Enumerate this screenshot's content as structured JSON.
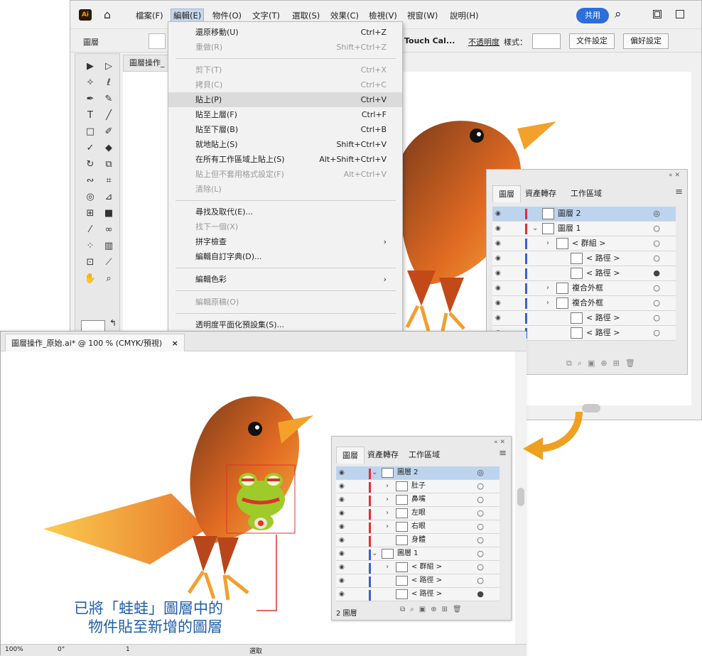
{
  "menubar": {
    "items": [
      "檔案(F)",
      "編輯(E)",
      "物件(O)",
      "文字(T)",
      "選取(S)",
      "效果(C)",
      "檢視(V)",
      "視窗(W)",
      "說明(H)"
    ],
    "share": "共用"
  },
  "control": {
    "panel_label": "圖層",
    "touch": "Touch Cal...",
    "opacity": "不透明度",
    "style": "樣式：",
    "doc_settings": "文件設定",
    "prefs": "偏好設定"
  },
  "doc_tab_back": "圖層操作_",
  "edit_menu": [
    {
      "label": "還原移動(U)",
      "shortcut": "Ctrl+Z",
      "disabled": false
    },
    {
      "label": "重做(R)",
      "shortcut": "Shift+Ctrl+Z",
      "disabled": true
    },
    {
      "sep": true
    },
    {
      "label": "剪下(T)",
      "shortcut": "Ctrl+X",
      "disabled": true
    },
    {
      "label": "拷貝(C)",
      "shortcut": "Ctrl+C",
      "disabled": true
    },
    {
      "label": "貼上(P)",
      "shortcut": "Ctrl+V",
      "disabled": false,
      "selected": true
    },
    {
      "label": "貼至上層(F)",
      "shortcut": "Ctrl+F",
      "disabled": false
    },
    {
      "label": "貼至下層(B)",
      "shortcut": "Ctrl+B",
      "disabled": false
    },
    {
      "label": "就地貼上(S)",
      "shortcut": "Shift+Ctrl+V",
      "disabled": false
    },
    {
      "label": "在所有工作區域上貼上(S)",
      "shortcut": "Alt+Shift+Ctrl+V",
      "disabled": false
    },
    {
      "label": "貼上但不套用格式設定(F)",
      "shortcut": "Alt+Ctrl+V",
      "disabled": true
    },
    {
      "label": "清除(L)",
      "shortcut": "",
      "disabled": true
    },
    {
      "sep": true
    },
    {
      "label": "尋找及取代(E)...",
      "shortcut": "",
      "disabled": false
    },
    {
      "label": "找下一個(X)",
      "shortcut": "",
      "disabled": true
    },
    {
      "label": "拼字檢查",
      "shortcut": "›",
      "disabled": false
    },
    {
      "label": "編輯自訂字典(D)...",
      "shortcut": "",
      "disabled": false
    },
    {
      "sep": true
    },
    {
      "label": "編輯色彩",
      "shortcut": "›",
      "disabled": false
    },
    {
      "sep": true
    },
    {
      "label": "編輯原稿(O)",
      "shortcut": "",
      "disabled": true
    },
    {
      "sep": true
    },
    {
      "label": "透明度平面化預設集(S)...",
      "shortcut": "",
      "disabled": false
    }
  ],
  "layers_back": {
    "tabs": [
      "圖層",
      "資產轉存",
      "工作區域"
    ],
    "rows": [
      {
        "label": "圖層 2",
        "indent": 0,
        "chev": "",
        "hl": true,
        "color": "#e03030",
        "tgt": "◎"
      },
      {
        "label": "圖層 1",
        "indent": 0,
        "chev": "⌄",
        "hl": false,
        "color": "#e03030",
        "tgt": "○"
      },
      {
        "label": "< 群組 >",
        "indent": 1,
        "chev": "›",
        "hl": false,
        "color": "#3a62c8",
        "tgt": "○"
      },
      {
        "label": "< 路徑 >",
        "indent": 2,
        "chev": "",
        "hl": false,
        "color": "#3a62c8",
        "tgt": "○"
      },
      {
        "label": "< 路徑 >",
        "indent": 2,
        "chev": "",
        "hl": false,
        "color": "#3a62c8",
        "tgt": "●"
      },
      {
        "label": "複合外框",
        "indent": 1,
        "chev": "›",
        "hl": false,
        "color": "#3a62c8",
        "tgt": "○"
      },
      {
        "label": "複合外框",
        "indent": 1,
        "chev": "›",
        "hl": false,
        "color": "#3a62c8",
        "tgt": "○"
      },
      {
        "label": "< 路徑 >",
        "indent": 2,
        "chev": "",
        "hl": false,
        "color": "#3a62c8",
        "tgt": "○"
      },
      {
        "label": "< 路徑 >",
        "indent": 2,
        "chev": "",
        "hl": false,
        "color": "#3a62c8",
        "tgt": "○"
      }
    ]
  },
  "front": {
    "tab": "圖層操作_原始.ai* @ 100 % (CMYK/預視)",
    "close": "×",
    "zoom": "100%",
    "angle": "0°",
    "page": "1",
    "status": "選取"
  },
  "layers_front": {
    "tabs": [
      "圖層",
      "資產轉存",
      "工作區域"
    ],
    "footer": "2 圖層",
    "rows": [
      {
        "label": "圖層 2",
        "indent": 0,
        "chev": "⌄",
        "hl": true,
        "color": "#e03030",
        "tgt": "◎"
      },
      {
        "label": "肚子",
        "indent": 1,
        "chev": "›",
        "hl": false,
        "color": "#e03030",
        "tgt": "○"
      },
      {
        "label": "鼻嘴",
        "indent": 1,
        "chev": "›",
        "hl": false,
        "color": "#e03030",
        "tgt": "○"
      },
      {
        "label": "左眼",
        "indent": 1,
        "chev": "›",
        "hl": false,
        "color": "#e03030",
        "tgt": "○"
      },
      {
        "label": "右眼",
        "indent": 1,
        "chev": "›",
        "hl": false,
        "color": "#e03030",
        "tgt": "○"
      },
      {
        "label": "身體",
        "indent": 1,
        "chev": "",
        "hl": false,
        "color": "#e03030",
        "tgt": "○"
      },
      {
        "label": "圖層 1",
        "indent": 0,
        "chev": "⌄",
        "hl": false,
        "color": "#3a62c8",
        "tgt": "○"
      },
      {
        "label": "< 群組 >",
        "indent": 1,
        "chev": "›",
        "hl": false,
        "color": "#3a62c8",
        "tgt": "○"
      },
      {
        "label": "< 路徑 >",
        "indent": 1,
        "chev": "",
        "hl": false,
        "color": "#3a62c8",
        "tgt": "○"
      },
      {
        "label": "< 路徑 >",
        "indent": 1,
        "chev": "",
        "hl": false,
        "color": "#3a62c8",
        "tgt": "●"
      }
    ]
  },
  "annotation": {
    "line1": "已將「蛙蛙」圖層中的",
    "line2": "物件貼至新增的圖層"
  }
}
